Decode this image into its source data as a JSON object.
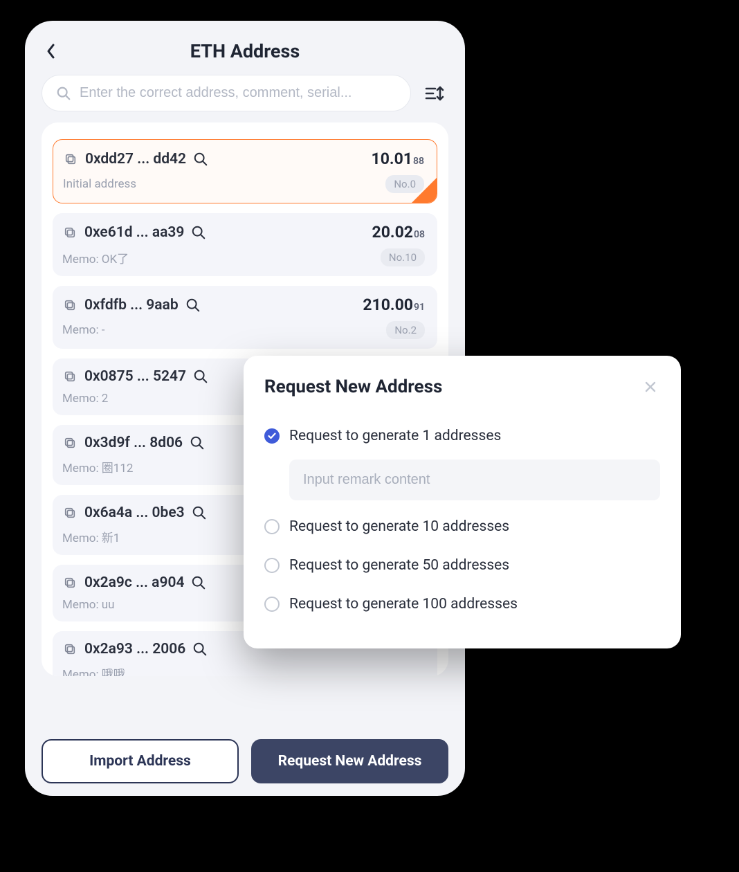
{
  "header": {
    "title": "ETH Address"
  },
  "search": {
    "placeholder": "Enter the correct address, comment, serial..."
  },
  "addresses": [
    {
      "addr": "0xdd27 ... dd42",
      "bal_main": "10.01",
      "bal_sub": "88",
      "memo": "Initial address",
      "no": "No.0",
      "selected": true
    },
    {
      "addr": "0xe61d ... aa39",
      "bal_main": "20.02",
      "bal_sub": "08",
      "memo": "Memo: OK了",
      "no": "No.10",
      "selected": false
    },
    {
      "addr": "0xfdfb ... 9aab",
      "bal_main": "210.00",
      "bal_sub": "91",
      "memo": "Memo: -",
      "no": "No.2",
      "selected": false
    },
    {
      "addr": "0x0875 ... 5247",
      "bal_main": "",
      "bal_sub": "",
      "memo": "Memo: 2",
      "no": "",
      "selected": false
    },
    {
      "addr": "0x3d9f ... 8d06",
      "bal_main": "",
      "bal_sub": "",
      "memo": "Memo: 圈112",
      "no": "",
      "selected": false
    },
    {
      "addr": "0x6a4a ... 0be3",
      "bal_main": "",
      "bal_sub": "",
      "memo": "Memo: 新1",
      "no": "",
      "selected": false
    },
    {
      "addr": "0x2a9c ... a904",
      "bal_main": "",
      "bal_sub": "",
      "memo": "Memo: uu",
      "no": "",
      "selected": false
    },
    {
      "addr": "0x2a93 ... 2006",
      "bal_main": "",
      "bal_sub": "",
      "memo": "Memo: 哦哦",
      "no": "",
      "selected": false
    }
  ],
  "footer": {
    "import": "Import Address",
    "request": "Request New Address"
  },
  "modal": {
    "title": "Request New Address",
    "remark_placeholder": "Input remark content",
    "options": [
      {
        "label": "Request to generate 1 addresses",
        "checked": true
      },
      {
        "label": "Request to generate 10 addresses",
        "checked": false
      },
      {
        "label": "Request to generate 50 addresses",
        "checked": false
      },
      {
        "label": "Request to generate 100 addresses",
        "checked": false
      }
    ]
  }
}
